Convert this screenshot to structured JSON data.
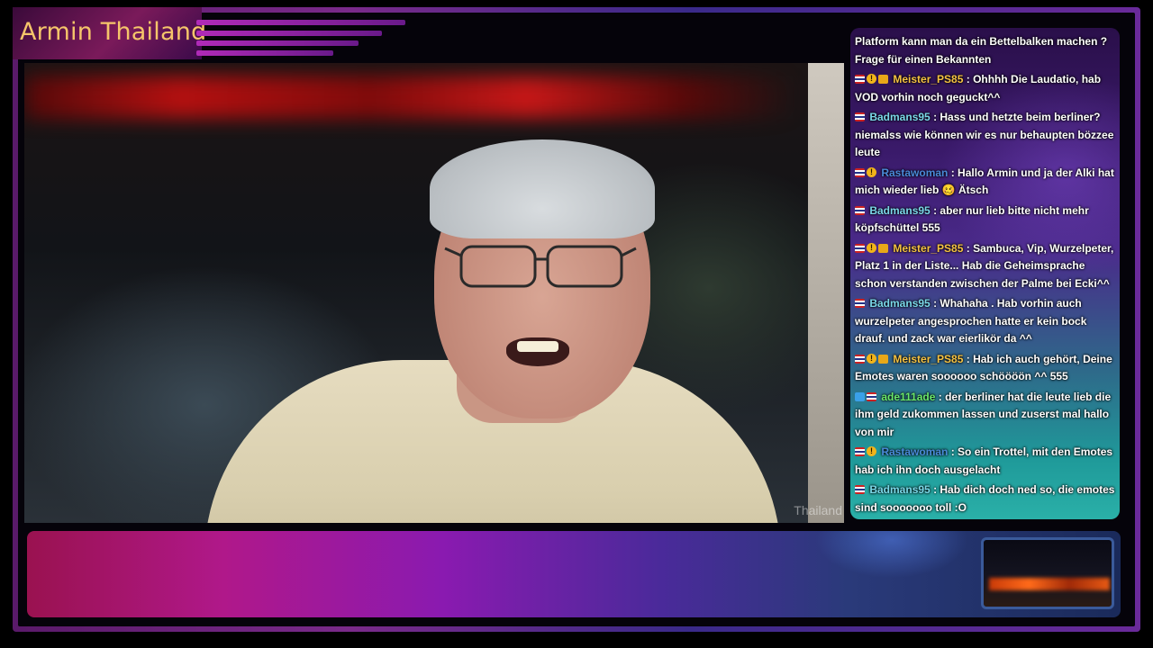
{
  "stream": {
    "title": "Armin Thailand",
    "watermark": "Thailand"
  },
  "colors": {
    "title_text": "#f5c56a",
    "chat_text": "#ffffff",
    "user_gold": "#f5c242",
    "user_teal": "#7ad8e8",
    "user_blue": "#4a8ad8",
    "user_green": "#6ae86a"
  },
  "chat": {
    "messages": [
      {
        "badges": [],
        "user": "",
        "text": "Platform kann man da ein Bettelbalken machen ? Frage für einen Bekannten",
        "user_color": "#ffffff"
      },
      {
        "badges": [
          "flag-icon",
          "warning-icon",
          "crown-icon"
        ],
        "user": "Meister_PS85",
        "text": ": Ohhhh Die Laudatio, hab VOD vorhin noch geguckt^^",
        "user_color": "#f5c242"
      },
      {
        "badges": [
          "flag-icon"
        ],
        "user": "Badmans95",
        "text": ": Hass und hetzte beim berliner? niemalss wie können wir es nur behaupten bözzee leute",
        "user_color": "#7ad8e8"
      },
      {
        "badges": [
          "flag-icon",
          "warning-icon"
        ],
        "user": "Rastawoman",
        "text": ": Hallo Armin und ja der Alki hat mich wieder lieb 🥴 Ätsch",
        "user_color": "#4a8ad8"
      },
      {
        "badges": [
          "flag-icon"
        ],
        "user": "Badmans95",
        "text": ": aber nur lieb bitte nicht mehr köpfschüttel 555",
        "user_color": "#7ad8e8"
      },
      {
        "badges": [
          "flag-icon",
          "warning-icon",
          "crown-icon"
        ],
        "user": "Meister_PS85",
        "text": ": Sambuca, Vip, Wurzelpeter, Platz 1 in der Liste... Hab die Geheimsprache schon verstanden zwischen der Palme bei Ecki^^",
        "user_color": "#f5c242"
      },
      {
        "badges": [
          "flag-icon"
        ],
        "user": "Badmans95",
        "text": ": Whahaha . Hab vorhin auch wurzelpeter angesprochen hatte er kein bock drauf. und zack war eierlikör da ^^",
        "user_color": "#7ad8e8"
      },
      {
        "badges": [
          "flag-icon",
          "warning-icon",
          "crown-icon"
        ],
        "user": "Meister_PS85",
        "text": ": Hab ich auch gehört, Deine Emotes waren soooooo schöööön ^^ 555",
        "user_color": "#f5c242"
      },
      {
        "badges": [
          "arrow-icon",
          "flag-icon"
        ],
        "user": "ade111ade",
        "text": ": der berliner hat die leute lieb die ihm geld zukommen lassen und zuserst mal hallo von mir",
        "user_color": "#6ae86a"
      },
      {
        "badges": [
          "flag-icon",
          "warning-icon"
        ],
        "user": "Rastawoman",
        "text": ": So ein Trottel, mit den Emotes hab ich ihn doch ausgelacht",
        "user_color": "#4a8ad8"
      },
      {
        "badges": [
          "flag-icon"
        ],
        "user": "Badmans95",
        "text": ": Hab dich doch ned so, die emotes sind sooooooo toll :O",
        "user_color": "#7ad8e8"
      }
    ]
  }
}
